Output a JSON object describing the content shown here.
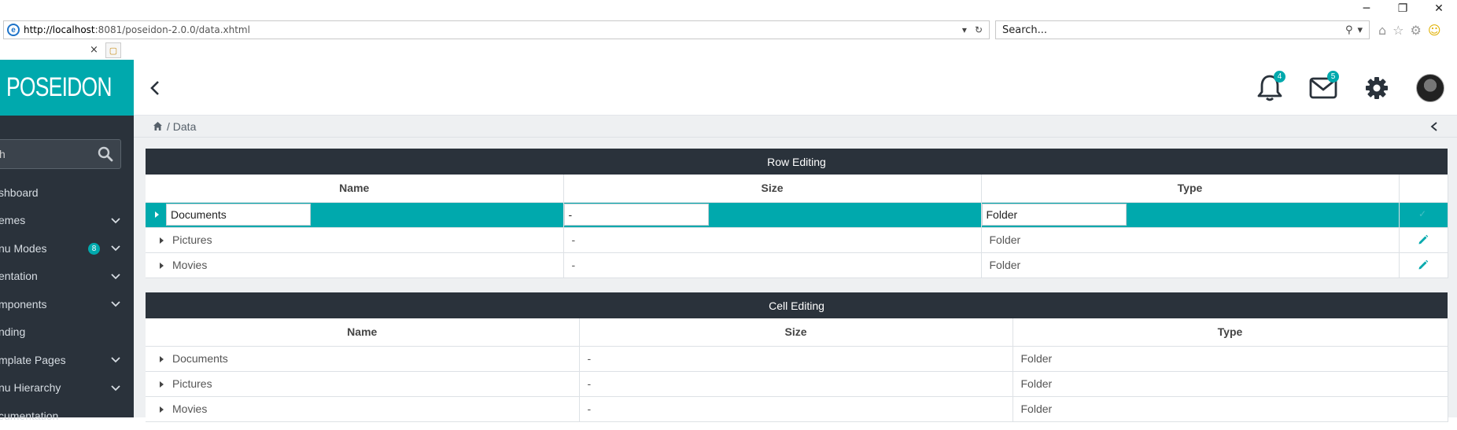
{
  "browser": {
    "url_host": "http://localhost",
    "url_rest": ":8081/poseidon-2.0.0/data.xhtml",
    "search_placeholder": "Search...",
    "tab_close": "×",
    "win_minimize": "─",
    "win_restore": "❐",
    "win_close": "✕"
  },
  "app": {
    "logo_text": "POSEIDON",
    "search_value": "h",
    "menu": [
      {
        "label": "shboard",
        "chevron": false,
        "badge": ""
      },
      {
        "label": "emes",
        "chevron": true,
        "badge": ""
      },
      {
        "label": "nu Modes",
        "chevron": true,
        "badge": "8"
      },
      {
        "label": "entation",
        "chevron": true,
        "badge": ""
      },
      {
        "label": "mponents",
        "chevron": true,
        "badge": ""
      },
      {
        "label": "nding",
        "chevron": false,
        "badge": ""
      },
      {
        "label": "mplate Pages",
        "chevron": true,
        "badge": ""
      },
      {
        "label": "nu Hierarchy",
        "chevron": true,
        "badge": ""
      },
      {
        "label": "cumentation",
        "chevron": false,
        "badge": ""
      }
    ],
    "notifications_count": "4",
    "messages_count": "5",
    "breadcrumb": "/ Data"
  },
  "row_editing": {
    "title": "Row Editing",
    "columns": [
      "Name",
      "Size",
      "Type"
    ],
    "rows": [
      {
        "name": "Documents",
        "size": "-",
        "type": "Folder",
        "editing": true
      },
      {
        "name": "Pictures",
        "size": "-",
        "type": "Folder",
        "editing": false
      },
      {
        "name": "Movies",
        "size": "-",
        "type": "Folder",
        "editing": false
      }
    ]
  },
  "cell_editing": {
    "title": "Cell Editing",
    "columns": [
      "Name",
      "Size",
      "Type"
    ],
    "rows": [
      {
        "name": "Documents",
        "size": "-",
        "type": "Folder"
      },
      {
        "name": "Pictures",
        "size": "-",
        "type": "Folder"
      },
      {
        "name": "Movies",
        "size": "-",
        "type": "Folder"
      }
    ]
  },
  "colors": {
    "accent": "#00a9ad",
    "dark": "#2a323b",
    "background": "#eef0f2"
  }
}
